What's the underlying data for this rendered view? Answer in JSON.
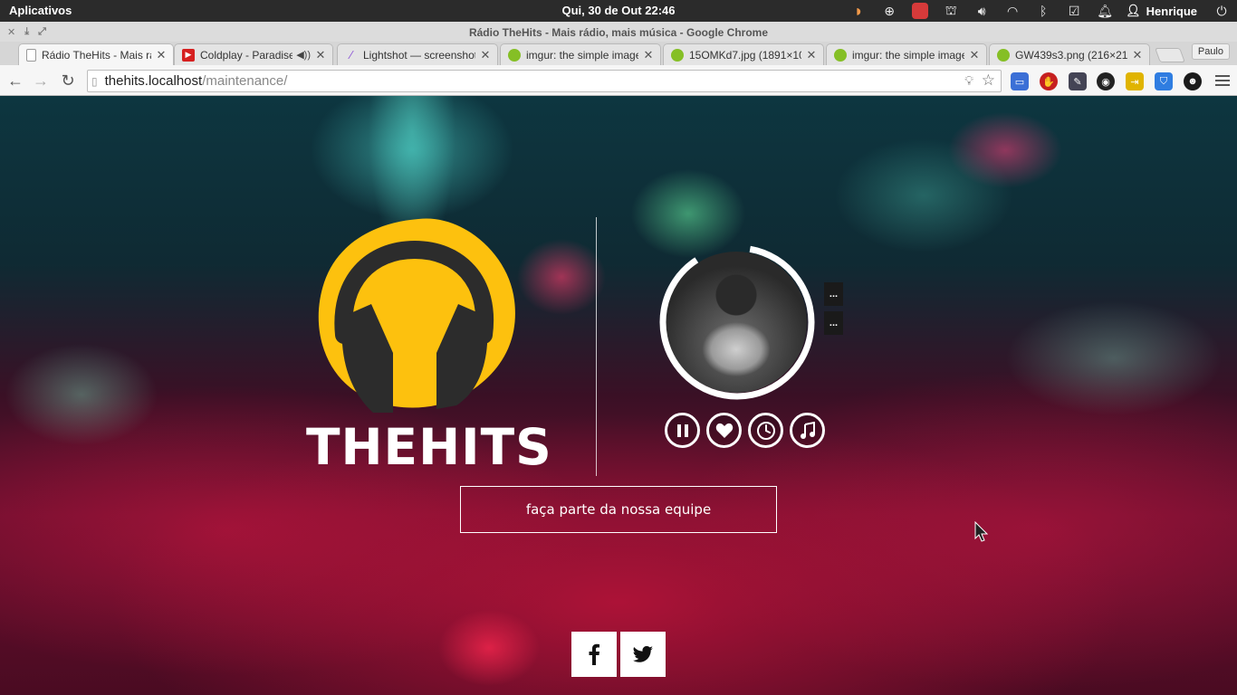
{
  "os": {
    "apps_label": "Aplicativos",
    "clock": "Qui, 30 de Out 22:46",
    "user": "Henrique"
  },
  "window": {
    "title": "Rádio TheHits - Mais rádio, mais música - Google Chrome"
  },
  "tabs": [
    {
      "title": "Rádio TheHits - Mais rádio",
      "icon": "page-icon",
      "active": true
    },
    {
      "title": "Coldplay - Paradise -",
      "icon": "youtube-icon",
      "audio": true
    },
    {
      "title": "Lightshot — screenshot",
      "icon": "feather-icon"
    },
    {
      "title": "imgur: the simple image",
      "icon": "imgur-icon"
    },
    {
      "title": "15OMKd7.jpg (1891×10",
      "icon": "imgur-icon"
    },
    {
      "title": "imgur: the simple image",
      "icon": "imgur-icon"
    },
    {
      "title": "GW439s3.png (216×21",
      "icon": "imgur-icon"
    }
  ],
  "profile_name": "Paulo",
  "address": {
    "host": "thehits.localhost",
    "path": "/maintenance/"
  },
  "page": {
    "brand": "THEHITS",
    "song_tags": [
      "...",
      "..."
    ],
    "join_label": "faça parte da nossa equipe",
    "player_progress": 0.88
  },
  "colors": {
    "brand_yellow": "#FDC10E",
    "brand_dark": "#2C2C2C"
  }
}
